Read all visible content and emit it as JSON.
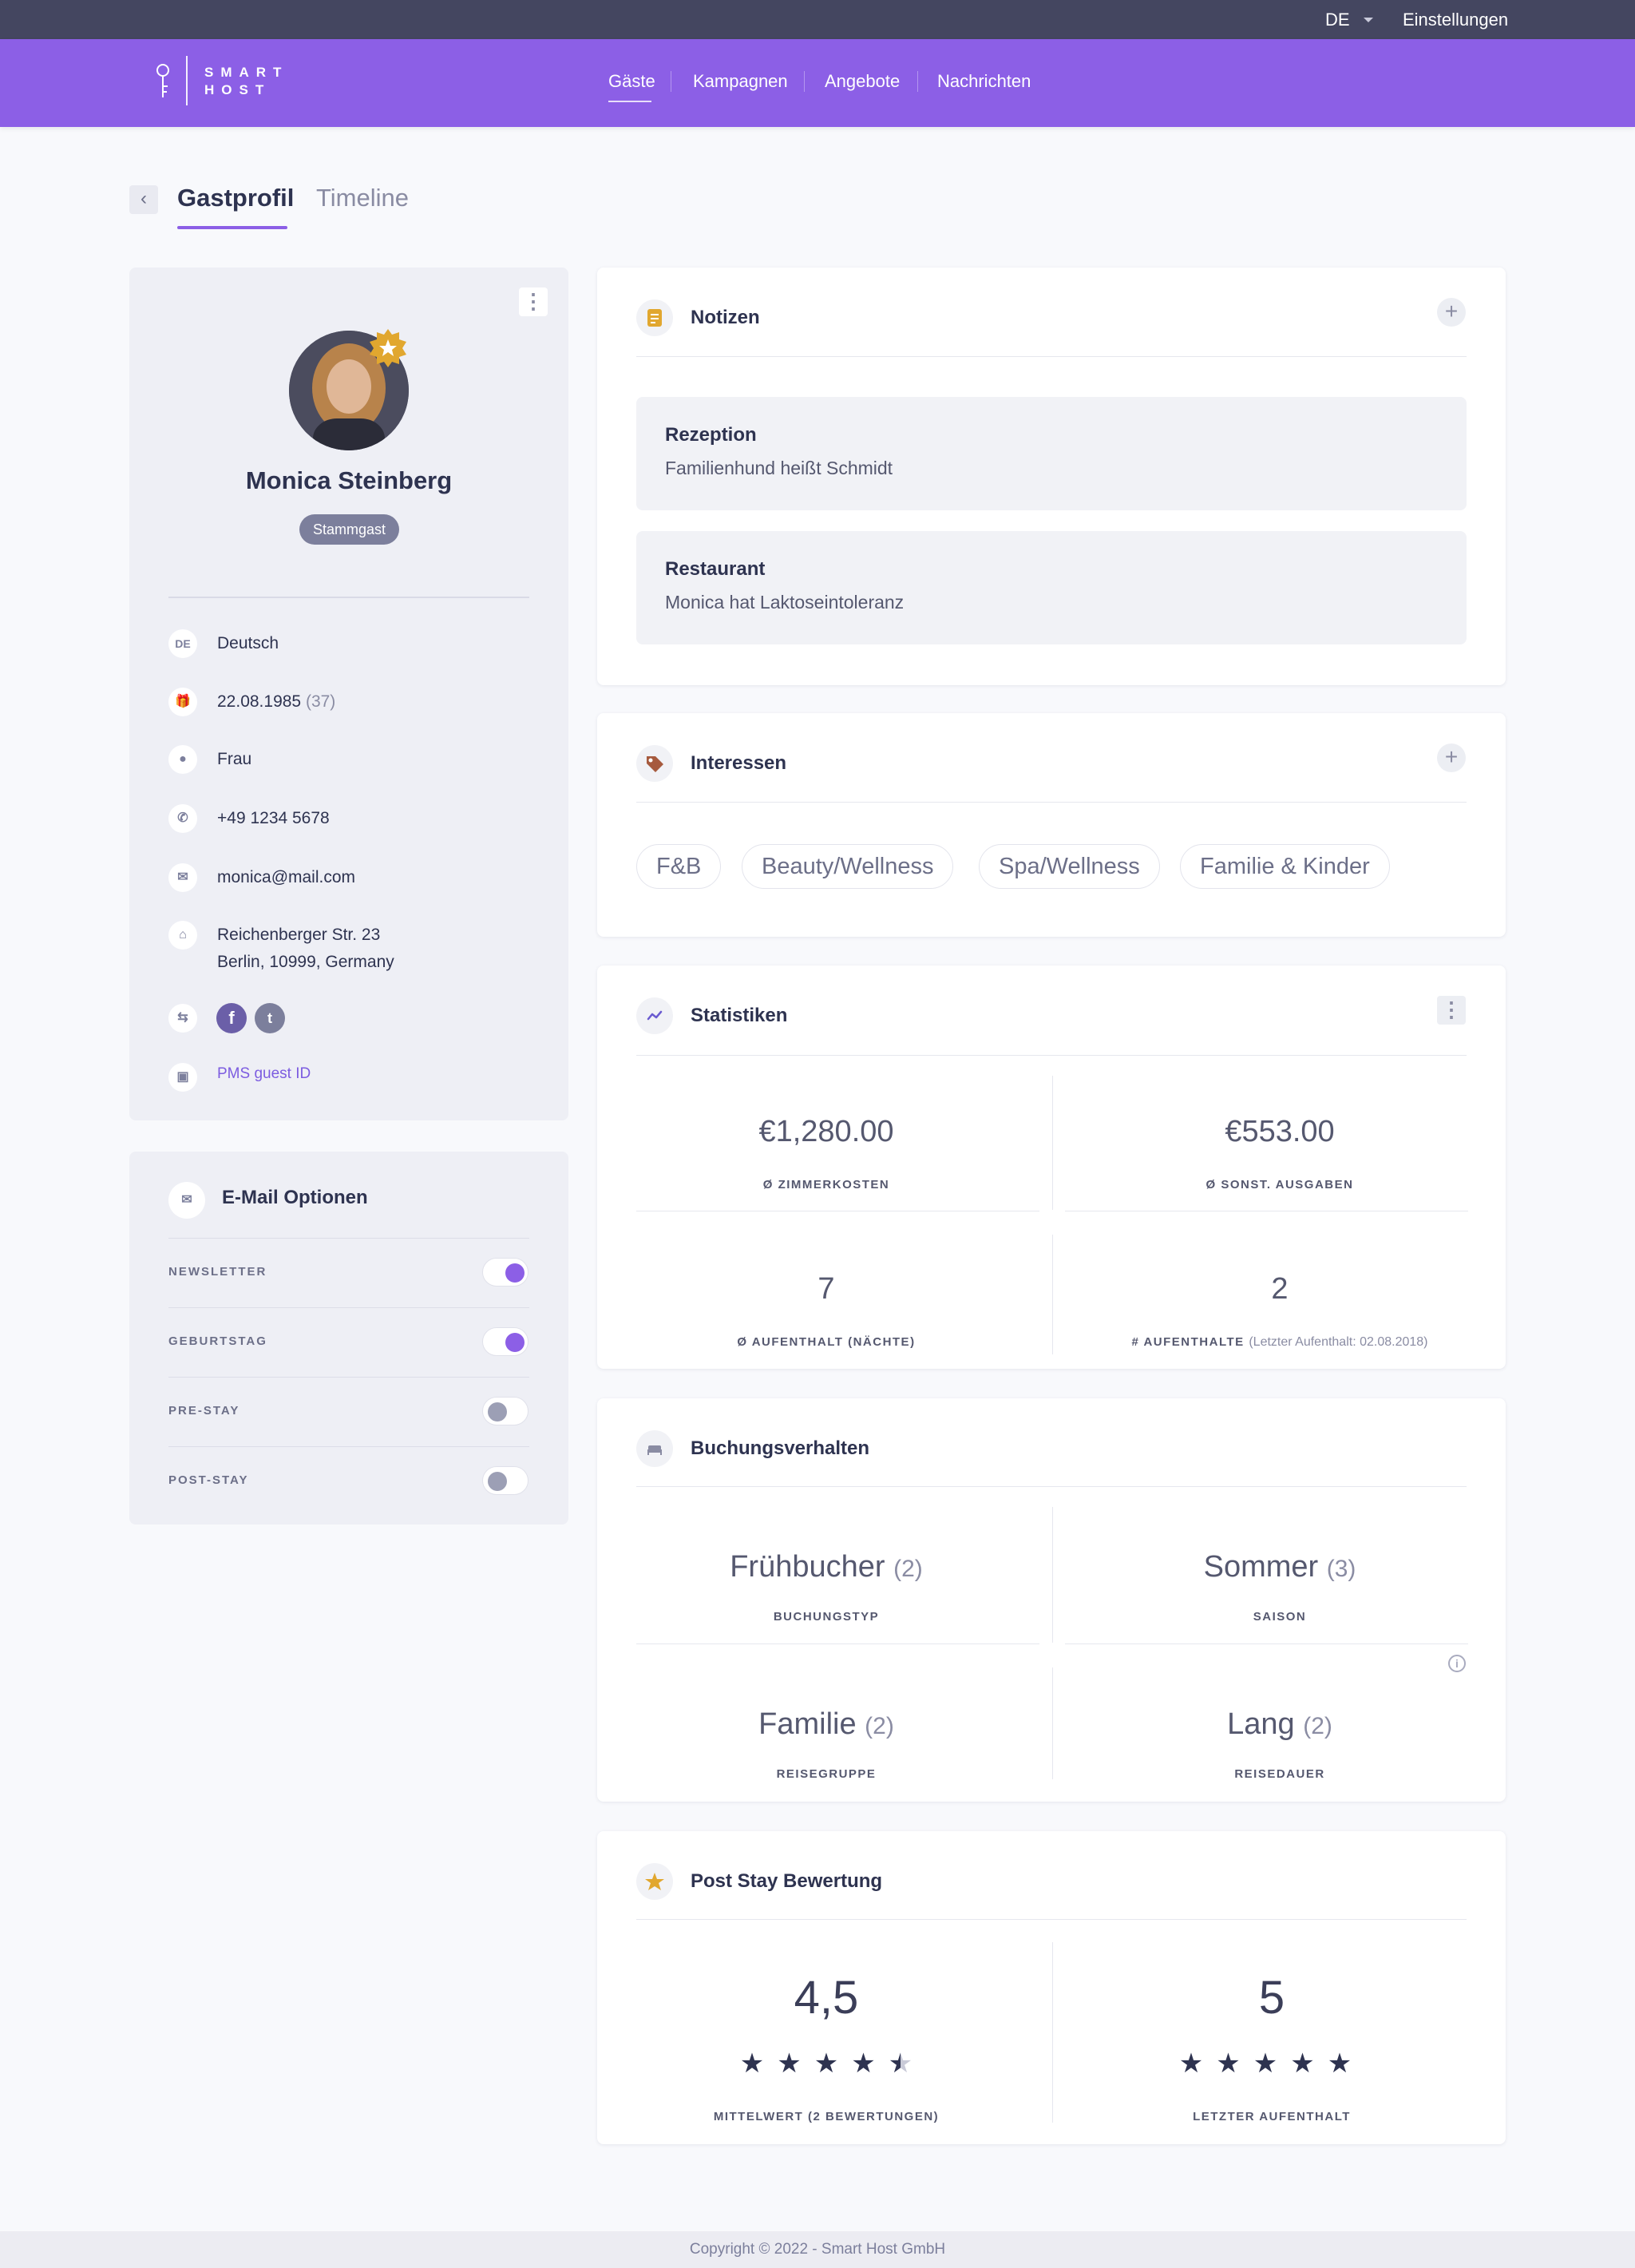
{
  "topbar": {
    "language": "DE",
    "settings_label": "Einstellungen"
  },
  "brand": {
    "line1": "SMART",
    "line2": "HOST"
  },
  "nav": {
    "items": [
      "Gäste",
      "Kampagnen",
      "Angebote",
      "Nachrichten"
    ]
  },
  "page": {
    "tab_active": "Gastprofil",
    "tab_other": "Timeline"
  },
  "profile": {
    "name": "Monica Steinberg",
    "badge": "Stammgast",
    "language_code": "DE",
    "language": "Deutsch",
    "birthday": "22.08.1985",
    "age": "(37)",
    "salutation": "Frau",
    "phone": "+49 1234 5678",
    "email": "monica@mail.com",
    "address_line1": "Reichenberger Str. 23",
    "address_line2": "Berlin, 10999, Germany",
    "pms_label": "PMS guest ID"
  },
  "email_options": {
    "title": "E-Mail Optionen",
    "options": [
      {
        "label": "NEWSLETTER",
        "enabled": true
      },
      {
        "label": "GEBURTSTAG",
        "enabled": true
      },
      {
        "label": "PRE-STAY",
        "enabled": false
      },
      {
        "label": "POST-STAY",
        "enabled": false
      }
    ]
  },
  "notes": {
    "title": "Notizen",
    "items": [
      {
        "title": "Rezeption",
        "text": "Familienhund heißt Schmidt"
      },
      {
        "title": "Restaurant",
        "text": "Monica hat Laktoseintoleranz"
      }
    ]
  },
  "interests": {
    "title": "Interessen",
    "items": [
      "F&B",
      "Beauty/Wellness",
      "Spa/Wellness",
      "Familie & Kinder"
    ]
  },
  "statistics": {
    "title": "Statistiken",
    "room_cost_value": "€1,280.00",
    "room_cost_label": "Ø ZIMMERKOSTEN",
    "other_expenses_value": "€553.00",
    "other_expenses_label": "Ø SONST. AUSGABEN",
    "avg_stay_value": "7",
    "avg_stay_label": "Ø AUFENTHALT (NÄCHTE)",
    "stays_value": "2",
    "stays_label": "# AUFENTHALTE",
    "stays_note": "(Letzter Aufenthalt: 02.08.2018)"
  },
  "booking": {
    "title": "Buchungsverhalten",
    "type_value": "Frühbucher",
    "type_count": "(2)",
    "type_label": "BUCHUNGSTYP",
    "season_value": "Sommer",
    "season_count": "(3)",
    "season_label": "SAISON",
    "group_value": "Familie",
    "group_count": "(2)",
    "group_label": "REISEGRUPPE",
    "duration_value": "Lang",
    "duration_count": "(2)",
    "duration_label": "REISEDAUER"
  },
  "rating": {
    "title": "Post Stay Bewertung",
    "average_value": "4,5",
    "average_label": "MITTELWERT (2 BEWERTUNGEN)",
    "last_value": "5",
    "last_label": "LETZTER AUFENTHALT",
    "average_stars": 4.5,
    "last_stars": 5
  },
  "footer": {
    "copyright": "Copyright © 2022 - Smart Host GmbH"
  },
  "colors": {
    "accent": "#8c5fe6",
    "topbar": "#444660",
    "star_gold": "#e1a72f"
  }
}
